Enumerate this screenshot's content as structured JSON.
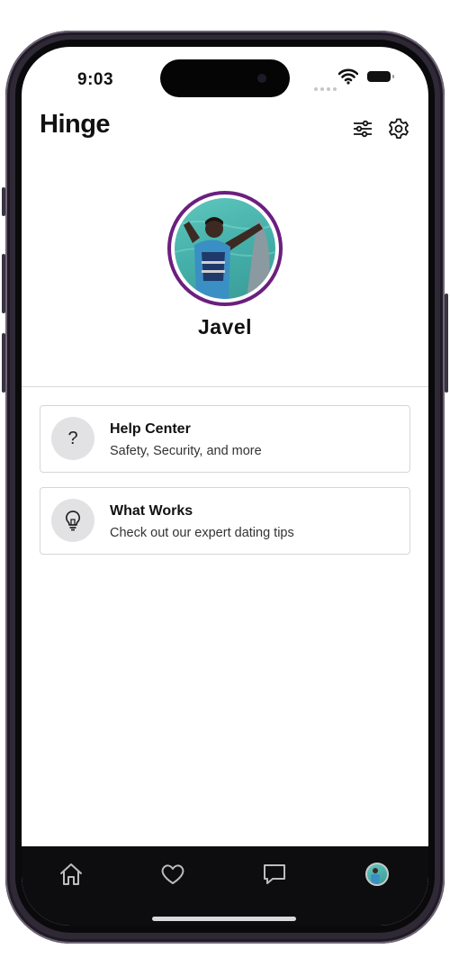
{
  "status_bar": {
    "time": "9:03"
  },
  "header": {
    "logo": "Hinge",
    "filter_icon": "sliders-icon",
    "settings_icon": "gear-icon"
  },
  "profile": {
    "name": "Javel",
    "ring_color": "#6b1f7e"
  },
  "cards": [
    {
      "title": "Help Center",
      "subtitle": "Safety, Security, and more",
      "icon": "question-mark-icon"
    },
    {
      "title": "What Works",
      "subtitle": "Check out our expert dating tips",
      "icon": "lightbulb-icon"
    }
  ],
  "tab_bar": {
    "tabs": [
      {
        "name": "home",
        "icon": "home-icon"
      },
      {
        "name": "likes",
        "icon": "heart-icon"
      },
      {
        "name": "matches",
        "icon": "chat-bubble-icon"
      },
      {
        "name": "profile",
        "icon": "avatar"
      }
    ]
  }
}
